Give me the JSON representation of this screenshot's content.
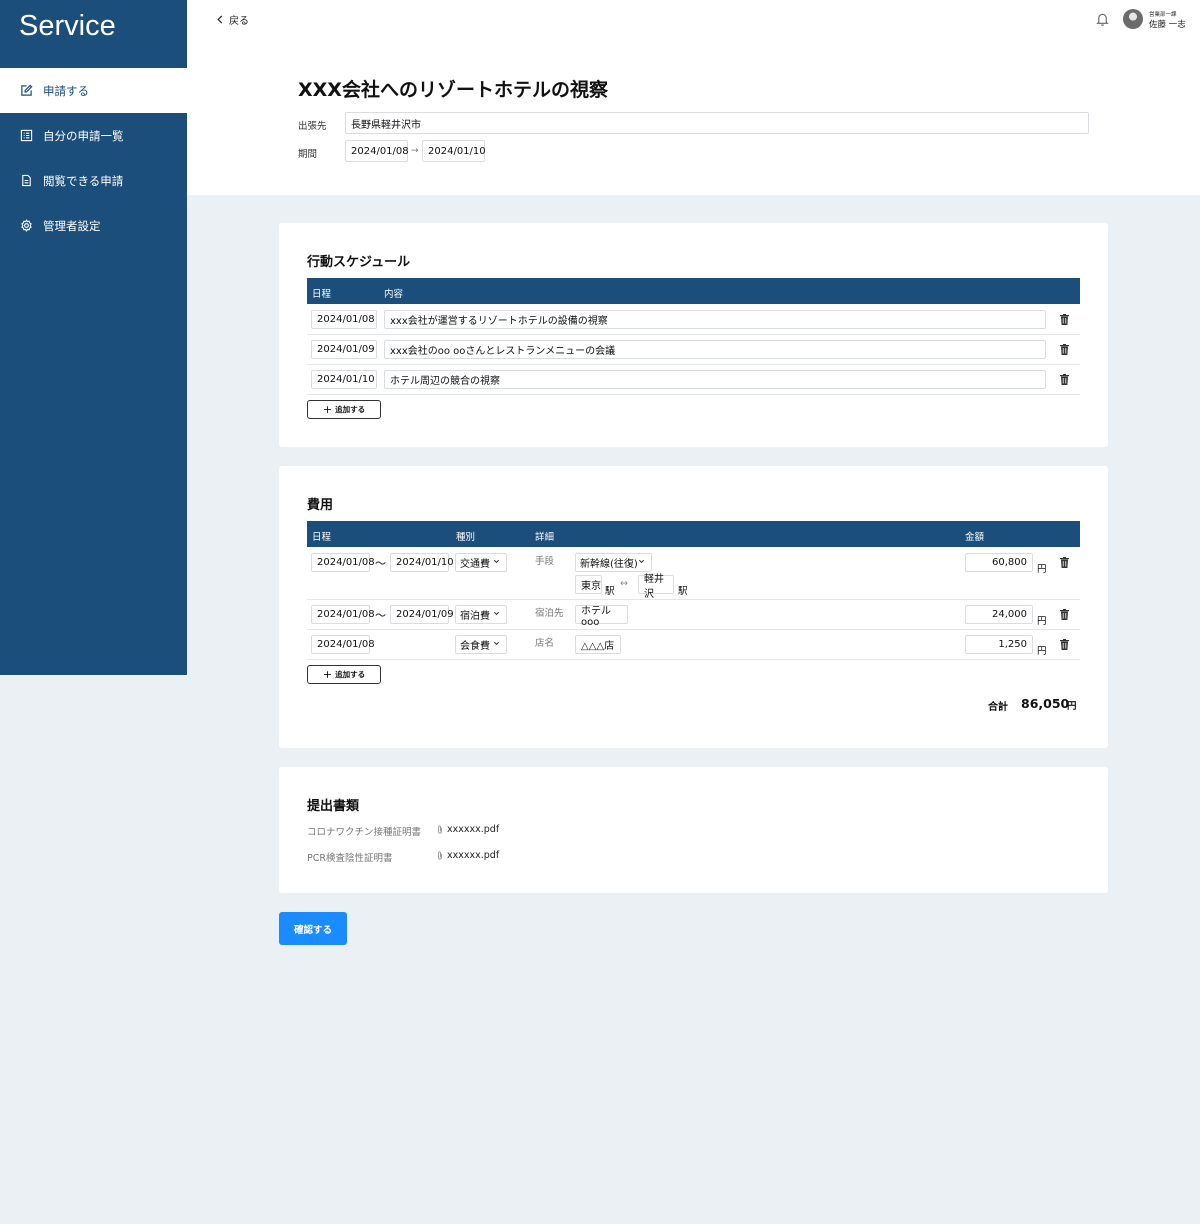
{
  "app": {
    "brand": "Service"
  },
  "sidebar": {
    "items": [
      {
        "label": "申請する",
        "icon": "edit-icon",
        "active": true
      },
      {
        "label": "自分の申請一覧",
        "icon": "list-icon"
      },
      {
        "label": "閲覧できる申請",
        "icon": "document-icon"
      },
      {
        "label": "管理者設定",
        "icon": "gear-icon"
      }
    ]
  },
  "header": {
    "back_label": "戻る",
    "user": {
      "department": "営業部一課",
      "name": "佐藤 一志"
    }
  },
  "request": {
    "title": "XXX会社へのリゾートホテルの視察",
    "destination_label": "出張先",
    "destination": "長野県軽井沢市",
    "period_label": "期間",
    "period_start": "2024/01/08",
    "period_end": "2024/01/10"
  },
  "schedule": {
    "title": "行動スケジュール",
    "headers": {
      "date": "日程",
      "content": "内容"
    },
    "rows": [
      {
        "date": "2024/01/08",
        "content": "xxx会社が運営するリゾートホテルの設備の視察"
      },
      {
        "date": "2024/01/09",
        "content": "xxx会社のoo ooさんとレストランメニューの会議"
      },
      {
        "date": "2024/01/10",
        "content": "ホテル周辺の競合の視察"
      }
    ],
    "add_label": "追加する"
  },
  "expenses": {
    "title": "費用",
    "headers": {
      "date": "日程",
      "type": "種別",
      "detail": "詳細",
      "amount": "金額"
    },
    "transport": {
      "date_from": "2024/01/08",
      "date_to": "2024/01/10",
      "type": "交通費",
      "detail_label": "手段",
      "method": "新幹線(往復)",
      "from_station": "東京",
      "to_station": "軽井沢",
      "station_suffix": "駅",
      "amount": "60,800"
    },
    "lodging": {
      "date_from": "2024/01/08",
      "date_to": "2024/01/09",
      "type": "宿泊費",
      "detail_label": "宿泊先",
      "place": "ホテルooo",
      "amount": "24,000"
    },
    "meal": {
      "date": "2024/01/08",
      "type": "会食費",
      "detail_label": "店名",
      "place": "△△△店",
      "amount": "1,250"
    },
    "range_sep": "〜",
    "yen": "円",
    "add_label": "追加する",
    "total_label": "合計",
    "total_value": "86,050",
    "total_unit": "円"
  },
  "documents": {
    "title": "提出書類",
    "items": [
      {
        "label": "コロナワクチン接種証明書",
        "file": "xxxxxx.pdf"
      },
      {
        "label": "PCR検査陰性証明書",
        "file": "xxxxxx.pdf"
      }
    ]
  },
  "confirm_label": "確認する",
  "colors": {
    "sidebar": "#1b4e7b",
    "primary_button": "#1a8cff",
    "background": "#ebf0f4"
  }
}
